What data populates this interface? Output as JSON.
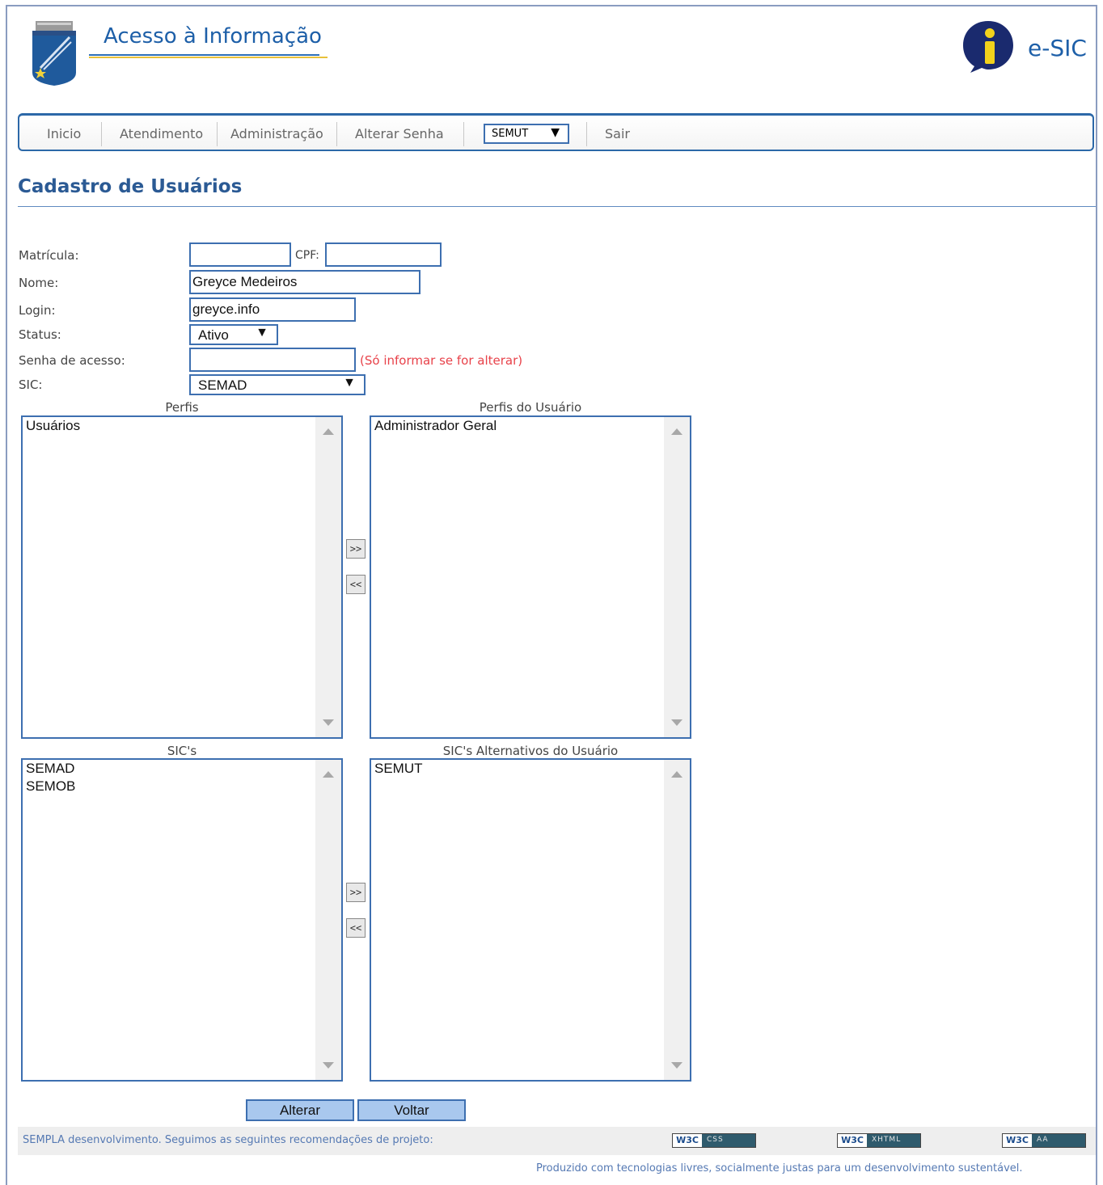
{
  "header": {
    "site_title": "Acesso à Informação",
    "esic_label": "e-SIC"
  },
  "menu": {
    "items": [
      "Inicio",
      "Atendimento",
      "Administração",
      "Alterar Senha"
    ],
    "sic_selected": "SEMUT",
    "logout": "Sair"
  },
  "page": {
    "title": "Cadastro de Usuários"
  },
  "form": {
    "matricula_label": "Matrícula:",
    "matricula_value": "",
    "cpf_label": "CPF:",
    "cpf_value": "",
    "nome_label": "Nome:",
    "nome_value": "Greyce Medeiros",
    "login_label": "Login:",
    "login_value": "greyce.info",
    "status_label": "Status:",
    "status_value": "Ativo",
    "senha_label": "Senha de acesso:",
    "senha_value": "",
    "senha_hint": "(Só informar se for alterar)",
    "sic_label": "SIC:",
    "sic_value": "SEMAD"
  },
  "perfis": {
    "available_caption": "Perfis",
    "available": [
      "Usuários"
    ],
    "assigned_caption": "Perfis do Usuário",
    "assigned": [
      "Administrador Geral"
    ]
  },
  "sics": {
    "available_caption": "SIC's",
    "available": [
      "SEMAD",
      "SEMOB"
    ],
    "assigned_caption": "SIC's Alternativos do Usuário",
    "assigned": [
      "SEMUT"
    ]
  },
  "movers": {
    "add": ">>",
    "remove": "<<"
  },
  "actions": {
    "alterar": "Alterar",
    "voltar": "Voltar"
  },
  "footer": {
    "text": "SEMPLA desenvolvimento. Seguimos as seguintes recomendações de projeto:",
    "badges": [
      {
        "org": "W3C",
        "kind": "CSS"
      },
      {
        "org": "W3C",
        "kind": "XHTML"
      },
      {
        "org": "W3C",
        "kind": "AA"
      }
    ],
    "produced": "Produzido com tecnologias livres, socialmente justas para um desenvolvimento sustentável."
  }
}
